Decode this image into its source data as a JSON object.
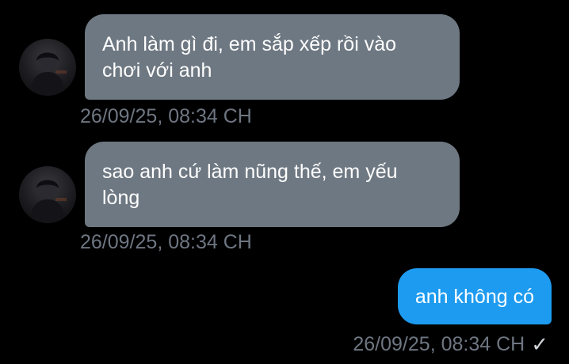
{
  "messages": [
    {
      "direction": "incoming",
      "text": "Anh làm gì đi, em sắp xếp rồi vào chơi với anh",
      "time": "26/09/25, 08:34 CH"
    },
    {
      "direction": "incoming",
      "text": "sao anh cứ làm nũng thế, em yếu lòng",
      "time": "26/09/25, 08:34 CH"
    },
    {
      "direction": "outgoing",
      "text": "anh không có",
      "time": "26/09/25, 08:34 CH",
      "status_icon": "check-icon",
      "status_glyph": "✓"
    }
  ],
  "colors": {
    "background": "#000000",
    "incoming_bubble": "#6e7882",
    "outgoing_bubble": "#1d9bf0",
    "timestamp": "#6e7682"
  }
}
